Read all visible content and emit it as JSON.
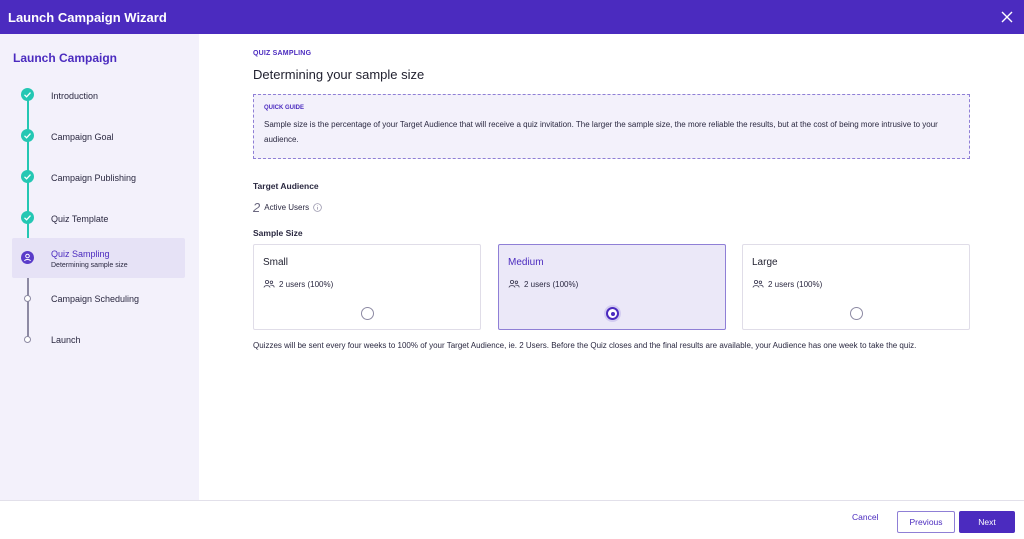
{
  "window": {
    "title": "Launch Campaign Wizard"
  },
  "sidebar": {
    "heading": "Launch Campaign",
    "steps": [
      {
        "label": "Introduction",
        "state": "done"
      },
      {
        "label": "Campaign Goal",
        "state": "done"
      },
      {
        "label": "Campaign Publishing",
        "state": "done"
      },
      {
        "label": "Quiz Template",
        "state": "done"
      },
      {
        "label": "Quiz Sampling",
        "sublabel": "Determining sample size",
        "state": "active"
      },
      {
        "label": "Campaign Scheduling",
        "state": "todo"
      },
      {
        "label": "Launch",
        "state": "todo"
      }
    ]
  },
  "main": {
    "eyebrow": "QUIZ SAMPLING",
    "title": "Determining your sample size",
    "guide": {
      "title": "QUICK GUIDE",
      "text": "Sample size is the percentage of your Target Audience that will receive a quiz invitation. The larger the sample size, the more reliable the results, but at the cost of being more intrusive to your audience."
    },
    "target_audience": {
      "label": "Target Audience",
      "count": "2",
      "count_label": "Active Users"
    },
    "sample_size": {
      "label": "Sample Size",
      "options": [
        {
          "title": "Small",
          "users": "2 users (100%)",
          "selected": false
        },
        {
          "title": "Medium",
          "users": "2 users (100%)",
          "selected": true
        },
        {
          "title": "Large",
          "users": "2 users (100%)",
          "selected": false
        }
      ]
    },
    "note": "Quizzes will be sent every four weeks to 100% of your Target Audience, ie. 2 Users. Before the Quiz closes and the final results are available, your Audience has one week to take the quiz."
  },
  "footer": {
    "cancel_label": "Cancel",
    "previous_label": "Previous",
    "next_label": "Next"
  },
  "colors": {
    "brand": "#4b2bbf",
    "done": "#24c7b3",
    "sidebar_bg": "#f3f1fb"
  }
}
